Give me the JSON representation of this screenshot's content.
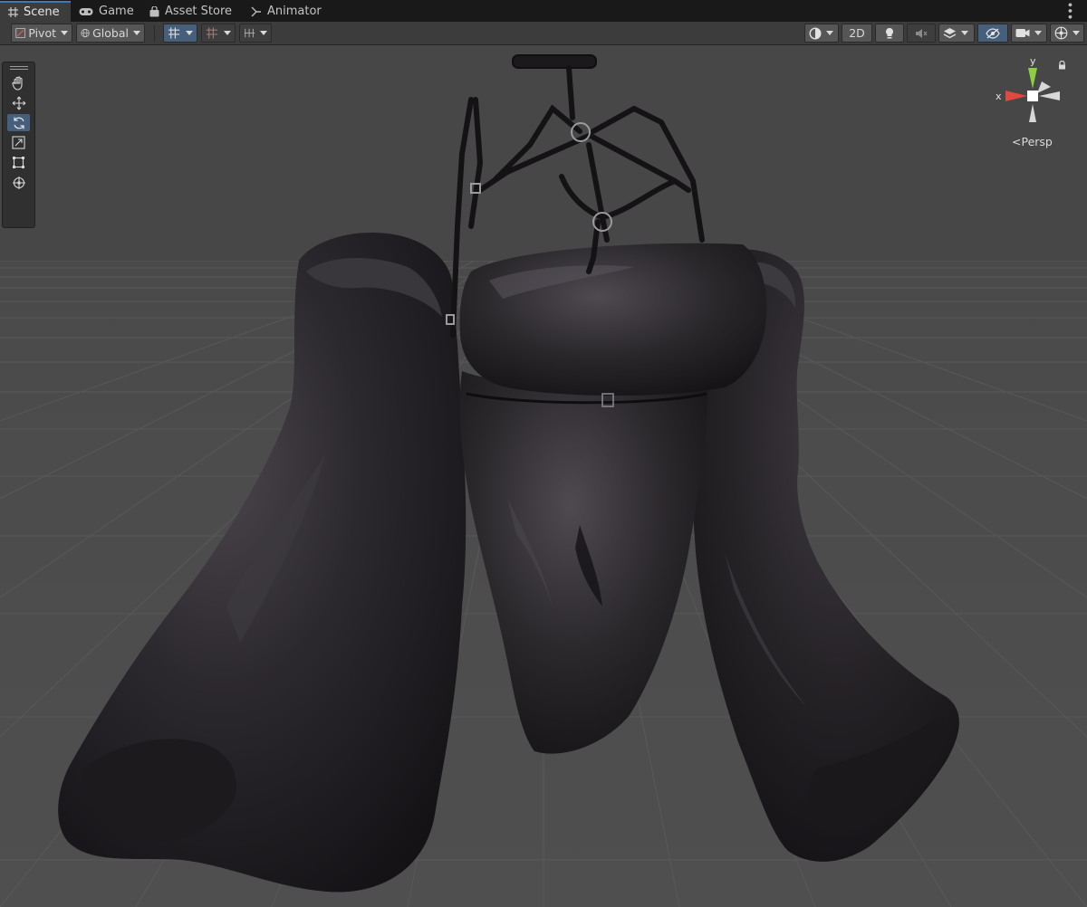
{
  "tabs": [
    {
      "label": "Scene",
      "icon": "grid-icon",
      "active": true
    },
    {
      "label": "Game",
      "icon": "gamepad-icon",
      "active": false
    },
    {
      "label": "Asset Store",
      "icon": "shopping-bag-icon",
      "active": false
    },
    {
      "label": "Animator",
      "icon": "animator-icon",
      "active": false
    }
  ],
  "toolbar": {
    "pivot_label": "Pivot",
    "global_label": "Global",
    "view_2d_label": "2D"
  },
  "gizmo": {
    "y_label": "y",
    "x_label": "x",
    "projection_label": "Persp"
  },
  "tools": [
    {
      "name": "hand-tool",
      "icon": "hand-icon",
      "active": false
    },
    {
      "name": "move-tool",
      "icon": "move-icon",
      "active": false
    },
    {
      "name": "rotate-tool",
      "icon": "rotate-icon",
      "active": true
    },
    {
      "name": "scale-tool",
      "icon": "scale-icon",
      "active": false
    },
    {
      "name": "rect-tool",
      "icon": "rect-icon",
      "active": false
    },
    {
      "name": "transform-tool",
      "icon": "transform-icon",
      "active": false
    }
  ],
  "colors": {
    "accent": "#3a79bb",
    "active_button": "#46607c",
    "x_axis": "#e0493f",
    "y_axis": "#8ecf3f"
  }
}
